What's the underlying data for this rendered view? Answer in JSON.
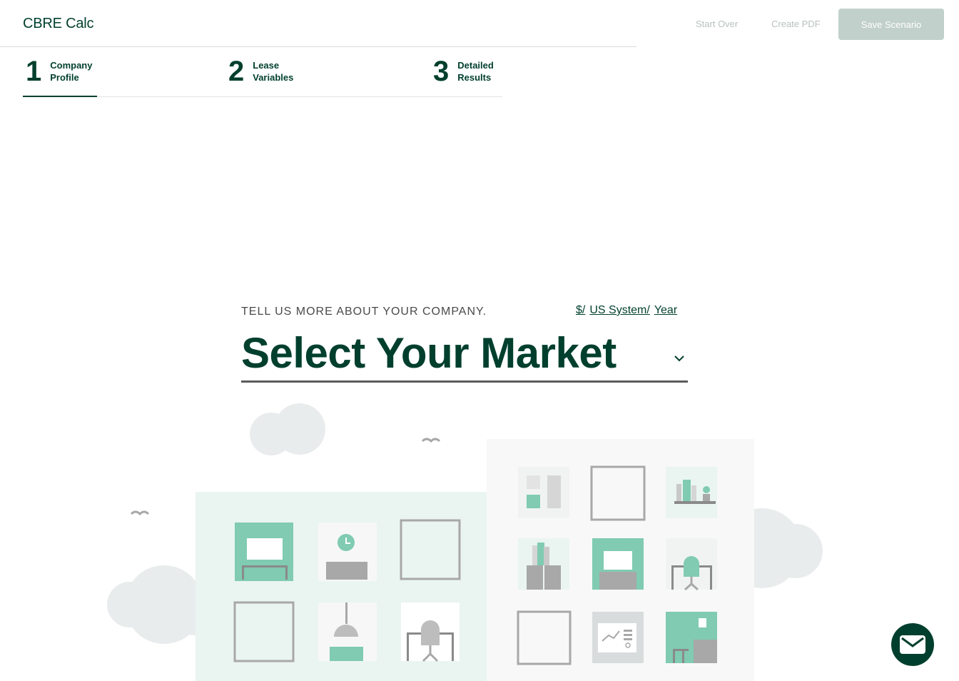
{
  "header": {
    "title": "CBRE Calc",
    "start_over": "Start Over",
    "create_pdf": "Create PDF",
    "save_scenario": "Save Scenario"
  },
  "steps": [
    {
      "number": "1",
      "label_line1": "Company",
      "label_line2": "Profile",
      "active": true
    },
    {
      "number": "2",
      "label_line1": "Lease",
      "label_line2": "Variables",
      "active": false
    },
    {
      "number": "3",
      "label_line1": "Detailed",
      "label_line2": "Results",
      "active": false
    }
  ],
  "main": {
    "prompt": "TELL US MORE ABOUT YOUR COMPANY.",
    "units": {
      "currency": "$/",
      "system": "US System/",
      "period": "Year"
    },
    "market_select": {
      "value": "Select Your Market",
      "icon": "chevron-down-icon"
    }
  },
  "colors": {
    "brand": "#003f2d",
    "accent": "#80cbb1",
    "light_accent": "#eaf5f1",
    "gray": "#a8a8a8",
    "cloud": "#e9ecec"
  },
  "mail_button": {
    "icon": "mail-icon"
  }
}
